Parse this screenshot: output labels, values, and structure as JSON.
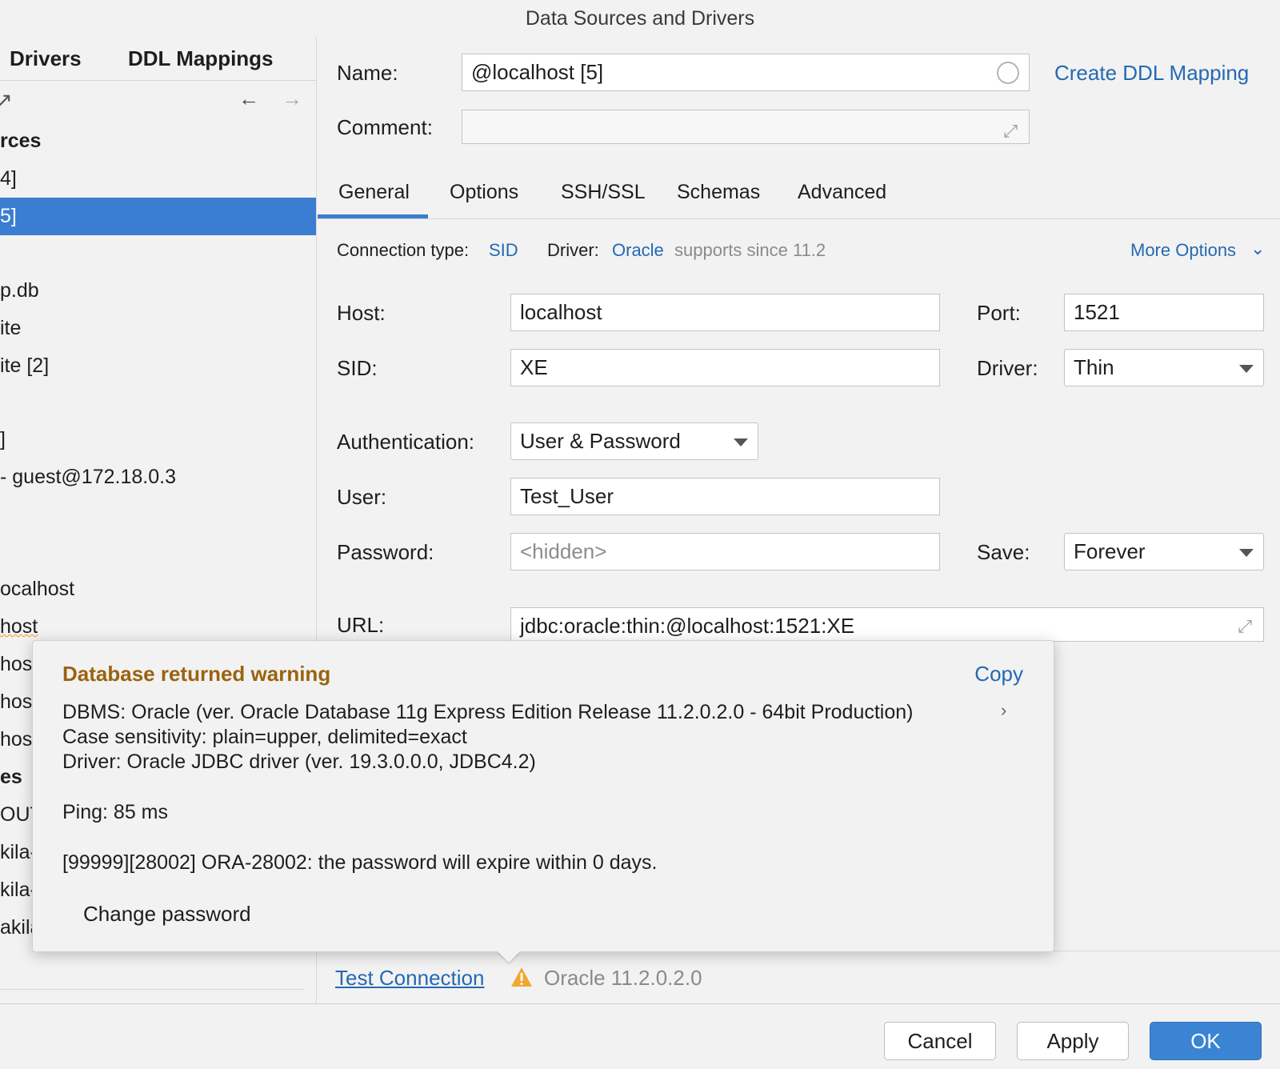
{
  "window": {
    "title": "Data Sources and Drivers"
  },
  "left": {
    "tabs": [
      "Drivers",
      "DDL Mappings"
    ],
    "items": [
      {
        "text": "rces",
        "bold": true
      },
      {
        "text": "4]"
      },
      {
        "text": "5]",
        "selected": true
      },
      {
        "text": ""
      },
      {
        "text": "p.db"
      },
      {
        "text": "ite"
      },
      {
        "text": "ite [2]"
      },
      {
        "text": ""
      },
      {
        "text": "]"
      },
      {
        "text": "- guest@172.18.0.3"
      },
      {
        "text": ""
      },
      {
        "text": ""
      },
      {
        "text": "ocalhost"
      },
      {
        "text": "host"
      },
      {
        "text": "hos"
      },
      {
        "text": "hos"
      },
      {
        "text": "hos"
      },
      {
        "text": "es",
        "bold": true
      },
      {
        "text": "OUT"
      },
      {
        "text": "kila-"
      },
      {
        "text": "kila-"
      },
      {
        "text": "akila-schema"
      }
    ]
  },
  "form": {
    "name_label": "Name:",
    "name_value": "@localhost [5]",
    "comment_label": "Comment:",
    "create_ddl_link": "Create DDL Mapping",
    "tabs": [
      "General",
      "Options",
      "SSH/SSL",
      "Schemas",
      "Advanced"
    ],
    "connection_type_label": "Connection type:",
    "connection_type_value": "SID",
    "driver_label": "Driver:",
    "driver_link": "Oracle",
    "driver_note": "supports since 11.2",
    "more_options": "More Options",
    "host_label": "Host:",
    "host_value": "localhost",
    "port_label": "Port:",
    "port_value": "1521",
    "sid_label": "SID:",
    "sid_value": "XE",
    "driver_select_label": "Driver:",
    "driver_select_value": "Thin",
    "auth_label": "Authentication:",
    "auth_value": "User & Password",
    "user_label": "User:",
    "user_value": "Test_User",
    "password_label": "Password:",
    "password_placeholder": "<hidden>",
    "save_label": "Save:",
    "save_value": "Forever",
    "url_label": "URL:",
    "url_value": "jdbc:oracle:thin:@localhost:1521:XE"
  },
  "popup": {
    "title": "Database returned warning",
    "copy": "Copy",
    "lines": [
      "DBMS: Oracle (ver. Oracle Database 11g Express Edition Release 11.2.0.2.0 - 64bit Production)",
      "Case sensitivity: plain=upper, delimited=exact",
      "Driver: Oracle JDBC driver (ver. 19.3.0.0.0, JDBC4.2)",
      "Ping: 85 ms",
      "[99999][28002] ORA-28002: the password will expire within 0 days."
    ],
    "change_password": "Change password"
  },
  "status": {
    "test_connection": "Test Connection",
    "version": "Oracle 11.2.0.2.0"
  },
  "buttons": {
    "cancel": "Cancel",
    "apply": "Apply",
    "ok": "OK"
  },
  "colors": {
    "accent": "#3b7dd0",
    "link": "#2469b3",
    "warning": "#9b6310"
  }
}
